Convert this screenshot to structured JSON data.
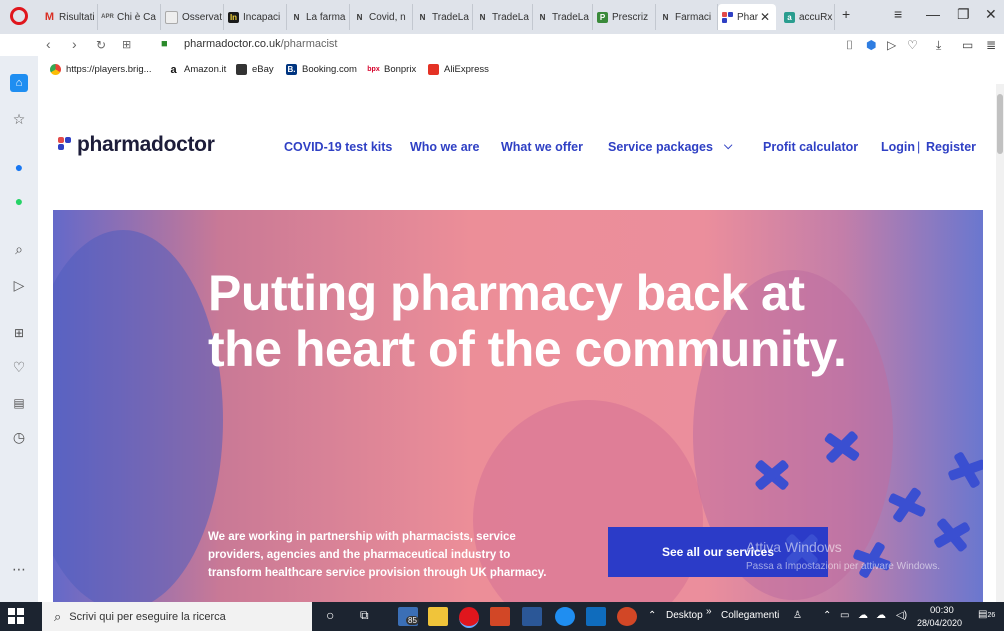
{
  "browser": {
    "tabs": [
      {
        "label": "Risultati",
        "icon": "gmail-icon",
        "color": "#d93025"
      },
      {
        "label": "Chi è Ca",
        "icon": "apr-icon",
        "color": "#555555"
      },
      {
        "label": "Osservat",
        "icon": "page-icon",
        "color": "#888888"
      },
      {
        "label": "Incapaci",
        "icon": "indeed-icon",
        "color": "#1a1a1a"
      },
      {
        "label": "La farma",
        "icon": "n-icon",
        "color": "#333333"
      },
      {
        "label": "Covid, n",
        "icon": "n-icon",
        "color": "#333333"
      },
      {
        "label": "TradeLa",
        "icon": "n-icon",
        "color": "#333333"
      },
      {
        "label": "TradeLa",
        "icon": "n-icon",
        "color": "#333333"
      },
      {
        "label": "TradeLa",
        "icon": "n-icon",
        "color": "#333333"
      },
      {
        "label": "Prescriz",
        "icon": "prescriz-icon",
        "color": "#3a8a3a"
      },
      {
        "label": "Farmaci",
        "icon": "n-icon",
        "color": "#333333"
      },
      {
        "label": "Phar",
        "icon": "pharmadoctor-icon",
        "color": "#e24a4a"
      },
      {
        "label": "accuRx",
        "icon": "accurx-icon",
        "color": "#2a9d8f"
      }
    ],
    "url_host": "pharmadoctor.co.uk",
    "url_path": "/pharmacist",
    "bookmarks": [
      {
        "label": "https://players.brig...",
        "icon": "chrome-like-icon"
      },
      {
        "label": "Amazon.it",
        "icon": "amazon-icon"
      },
      {
        "label": "eBay",
        "icon": "ebay-icon"
      },
      {
        "label": "Booking.com",
        "icon": "booking-icon"
      },
      {
        "label": "Bonprix",
        "icon": "bonprix-icon"
      },
      {
        "label": "AliExpress",
        "icon": "aliexpress-icon"
      }
    ]
  },
  "site": {
    "logo": "pharmadoctor",
    "nav": {
      "covid": "COVID-19 test kits",
      "who": "Who we are",
      "offer": "What we offer",
      "packages": "Service packages",
      "profit": "Profit calculator",
      "login": "Login",
      "separator": "|",
      "register": "Register"
    },
    "hero": {
      "title": "Putting pharmacy back at the heart of the community.",
      "text": "We are working in partnership with pharmacists, service providers, agencies and the pharmaceutical industry to transform healthcare service provision through UK pharmacy.",
      "cta": "See all our services"
    },
    "watermark": {
      "line1": "Attiva Windows",
      "line2": "Passa a Impostazioni per attivare Windows."
    }
  },
  "taskbar": {
    "search_placeholder": "Scrivi qui per eseguire la ricerca",
    "weather_badge": "85",
    "desktop": "Desktop",
    "links": "Collegamenti",
    "time": "00:30",
    "date": "28/04/2020",
    "notifications": "26"
  },
  "colors": {
    "brand_blue": "#2f40c4",
    "cta_blue": "#2b3bc8",
    "hero_pink": "#ec8e98"
  }
}
